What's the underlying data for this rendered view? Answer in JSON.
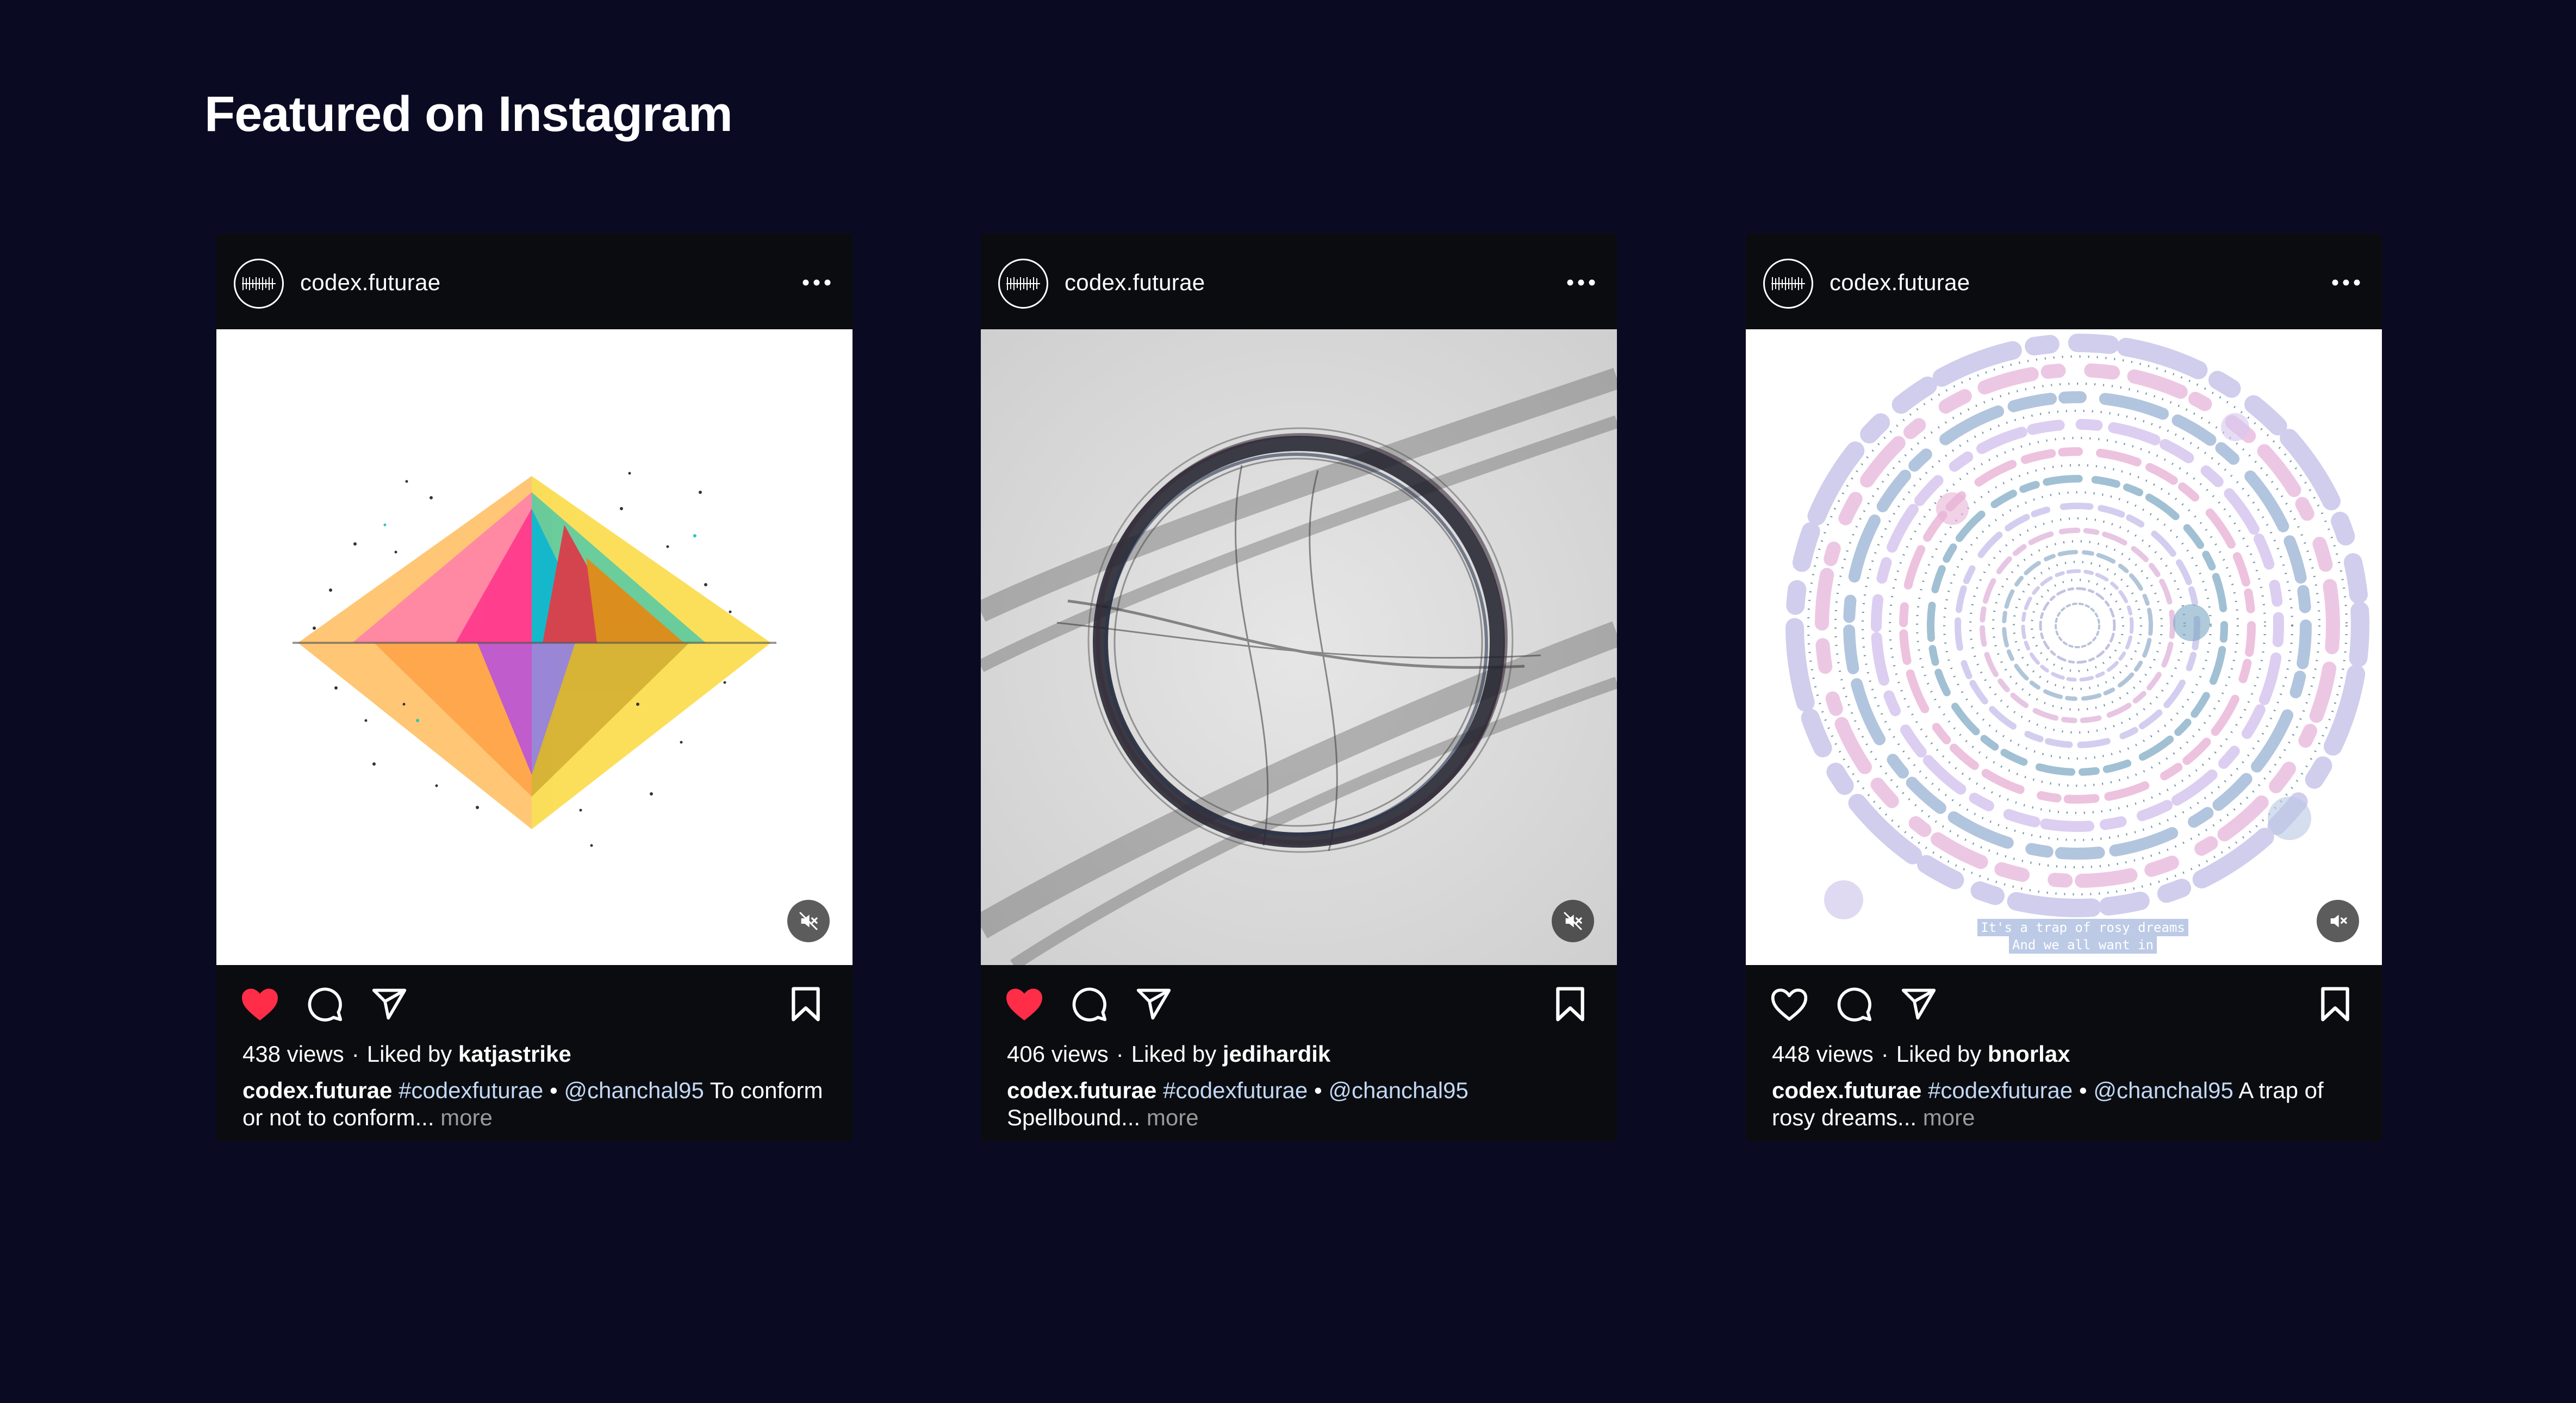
{
  "page": {
    "title": "Featured on Instagram"
  },
  "colors": {
    "background": "#0a0b23",
    "card": "#0b0c10",
    "like_active": "#ff2d48",
    "hashtag": "#c2d8f5",
    "more": "#9a9a9a"
  },
  "posts": [
    {
      "username": "codex.futurae",
      "views": "438 views",
      "liked_prefix": "Liked by",
      "liked_by": "katjastrike",
      "caption_user": "codex.futurae",
      "hashtag": "#codexfuturae",
      "mention": "@chanchal95",
      "caption_text": "To conform or not to conform...",
      "more_label": "more",
      "liked": true,
      "artwork": "colorful-diamond"
    },
    {
      "username": "codex.futurae",
      "views": "406 views",
      "liked_prefix": "Liked by",
      "liked_by": "jedihardik",
      "caption_user": "codex.futurae",
      "hashtag": "#codexfuturae",
      "mention": "@chanchal95",
      "caption_text": "Spellbound...",
      "more_label": "more",
      "liked": true,
      "artwork": "ink-ring"
    },
    {
      "username": "codex.futurae",
      "views": "448 views",
      "liked_prefix": "Liked by",
      "liked_by": "bnorlax",
      "caption_user": "codex.futurae",
      "hashtag": "#codexfuturae",
      "mention": "@chanchal95",
      "caption_text": "A trap of rosy dreams...",
      "more_label": "more",
      "liked": false,
      "artwork": "spiral-dots",
      "overlay_text": [
        "It's a trap of rosy dreams",
        "And we all want in"
      ]
    }
  ],
  "icons": {
    "more": "more-horizontal-icon",
    "mute": "speaker-muted-icon",
    "like": "heart-icon",
    "comment": "comment-icon",
    "share": "paper-plane-icon",
    "save": "bookmark-icon"
  }
}
